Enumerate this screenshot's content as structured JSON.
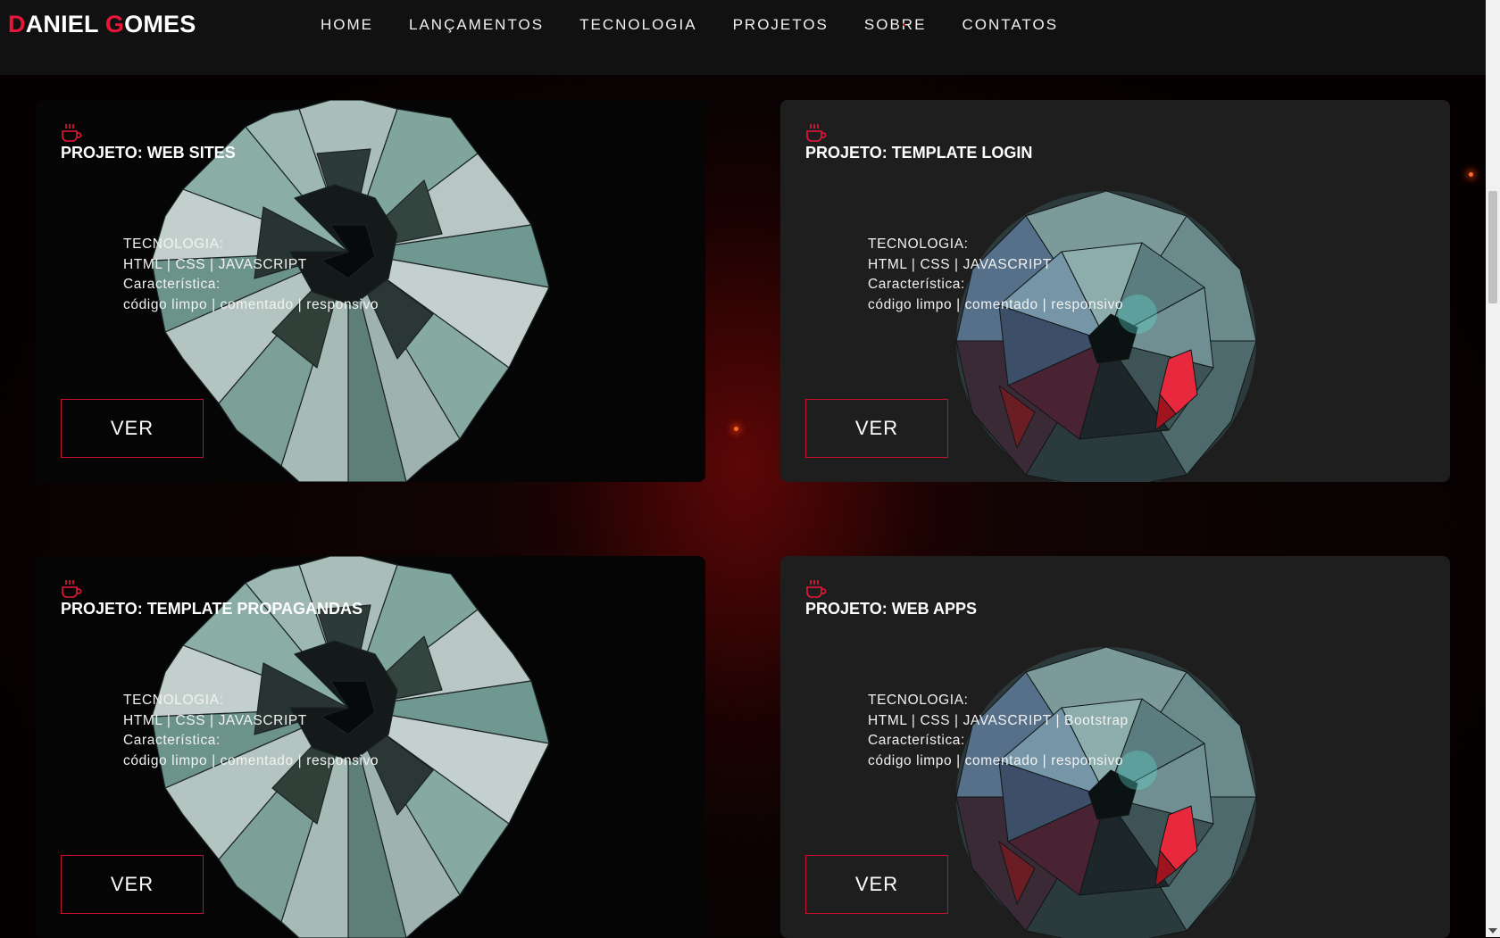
{
  "brand": {
    "first_initial": "D",
    "first_rest": "ANIEL ",
    "last_initial": "G",
    "last_rest": "OMES"
  },
  "nav": {
    "items": [
      "HOME",
      "LANÇAMENTOS",
      "TECNOLOGIA",
      "PROJETOS",
      "SOBRE",
      "CONTATOS"
    ]
  },
  "colors": {
    "accent": "#e8173a",
    "button_border": "#c8102e",
    "navbar_bg": "#111111",
    "card_dark_bg": "#050505",
    "card_gray_bg": "#1e1e1e"
  },
  "cards": [
    {
      "icon": "coffee-cup-icon",
      "title": "PROJETO: WEB SITES",
      "tech_label": "TECNOLOGIA:",
      "tech": "HTML | CSS | JAVASCRIPT",
      "feature_label": "Característica:",
      "features": "código limpo | comentado | responsivo",
      "button": "VER",
      "art": "low-poly-flower-sculpture"
    },
    {
      "icon": "coffee-cup-icon",
      "title": "PROJETO: TEMPLATE LOGIN",
      "tech_label": "TECNOLOGIA:",
      "tech": "HTML | CSS | JAVASCRIPT",
      "feature_label": "Característica:",
      "features": "código limpo | comentado | responsivo",
      "button": "VER",
      "art": "low-poly-sphere"
    },
    {
      "icon": "coffee-cup-icon",
      "title": "PROJETO: TEMPLATE PROPAGANDAS",
      "tech_label": "TECNOLOGIA:",
      "tech": "HTML | CSS | JAVASCRIPT",
      "feature_label": "Característica:",
      "features": "código limpo | comentado | responsivo",
      "button": "VER",
      "art": "low-poly-flower-sculpture"
    },
    {
      "icon": "coffee-cup-icon",
      "title": "PROJETO: WEB APPS",
      "tech_label": "TECNOLOGIA:",
      "tech": "HTML | CSS | JAVASCRIPT | Bootstrap",
      "feature_label": "Característica:",
      "features": "código limpo | comentado | responsivo",
      "button": "VER",
      "art": "low-poly-sphere"
    }
  ]
}
